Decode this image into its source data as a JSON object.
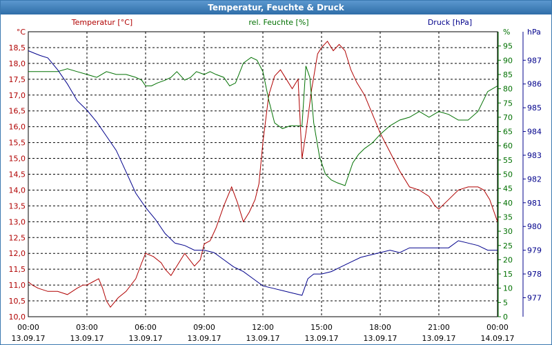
{
  "window": {
    "title": "Temperatur, Feuchte & Druck"
  },
  "colors": {
    "temperature": "#b00000",
    "humidity": "#007000",
    "pressure": "#00008b",
    "grid": "#000000"
  },
  "chart_data": {
    "type": "line",
    "title": "Temperatur, Feuchte & Druck",
    "grid": true,
    "x_ticks": [
      {
        "time": "00:00",
        "date": "13.09.17"
      },
      {
        "time": "03:00",
        "date": "13.09.17"
      },
      {
        "time": "06:00",
        "date": "13.09.17"
      },
      {
        "time": "09:00",
        "date": "13.09.17"
      },
      {
        "time": "12:00",
        "date": "13.09.17"
      },
      {
        "time": "15:00",
        "date": "13.09.17"
      },
      {
        "time": "18:00",
        "date": "13.09.17"
      },
      {
        "time": "21:00",
        "date": "13.09.17"
      },
      {
        "time": "00:00",
        "date": "14.09.17"
      }
    ],
    "x_range_hours": [
      0,
      24
    ],
    "axes": {
      "temperature": {
        "label": "Temperatur [°C]",
        "unit": "°C",
        "min": 10.0,
        "max": 19.0,
        "ticks": [
          "10,0",
          "10,5",
          "11,0",
          "11,5",
          "12,0",
          "12,5",
          "13,0",
          "13,5",
          "14,0",
          "14,5",
          "15,0",
          "15,5",
          "16,0",
          "16,5",
          "17,0",
          "17,5",
          "18,0",
          "18,5"
        ]
      },
      "humidity": {
        "label": "rel. Feuchte [%]",
        "unit": "%",
        "min": 0,
        "max": 100,
        "ticks": [
          "0",
          "5",
          "10",
          "15",
          "20",
          "25",
          "30",
          "35",
          "40",
          "45",
          "50",
          "55",
          "60",
          "65",
          "70",
          "75",
          "80",
          "85",
          "90",
          "95"
        ]
      },
      "pressure": {
        "label": "Druck [hPa]",
        "unit": "hPa",
        "min": 976.2,
        "max": 988.2,
        "ticks": [
          "977",
          "978",
          "979",
          "980",
          "981",
          "982",
          "983",
          "984",
          "985",
          "986",
          "987"
        ]
      }
    },
    "series": [
      {
        "name": "Temperatur [°C]",
        "axis": "temperature",
        "color": "#b00000",
        "x": [
          0,
          0.2,
          0.5,
          1,
          1.5,
          2,
          2.5,
          2.8,
          3,
          3.3,
          3.6,
          3.8,
          4,
          4.2,
          4.6,
          5,
          5.5,
          5.8,
          6,
          6.4,
          6.8,
          7,
          7.3,
          7.6,
          8,
          8.5,
          8.8,
          9,
          9.3,
          9.6,
          10,
          10.4,
          10.7,
          11,
          11.3,
          11.6,
          11.8,
          12,
          12.3,
          12.6,
          12.9,
          13.2,
          13.5,
          13.8,
          14,
          14.2,
          14.5,
          14.8,
          15,
          15.3,
          15.6,
          15.9,
          16.2,
          16.5,
          16.8,
          17.2,
          17.6,
          18,
          18.5,
          19,
          19.5,
          20,
          20.5,
          20.8,
          21,
          21.5,
          22,
          22.5,
          23,
          23.3,
          23.6,
          24
        ],
        "y": [
          11.1,
          11.0,
          10.9,
          10.8,
          10.8,
          10.7,
          10.9,
          11.0,
          11.0,
          11.1,
          11.2,
          10.9,
          10.5,
          10.3,
          10.6,
          10.8,
          11.2,
          11.7,
          12.0,
          11.9,
          11.7,
          11.5,
          11.3,
          11.6,
          12.0,
          11.6,
          11.8,
          12.3,
          12.4,
          12.8,
          13.5,
          14.1,
          13.6,
          13.0,
          13.3,
          13.7,
          14.2,
          15.5,
          17.0,
          17.6,
          17.8,
          17.5,
          17.2,
          17.5,
          15.0,
          15.8,
          17.2,
          18.3,
          18.5,
          18.7,
          18.4,
          18.6,
          18.4,
          17.8,
          17.4,
          17.0,
          16.4,
          15.8,
          15.2,
          14.6,
          14.1,
          14.0,
          13.8,
          13.5,
          13.4,
          13.7,
          14.0,
          14.1,
          14.1,
          14.0,
          13.7,
          13.0
        ]
      },
      {
        "name": "rel. Feuchte [%]",
        "axis": "humidity",
        "color": "#007000",
        "x": [
          0,
          0.5,
          1,
          1.5,
          2,
          2.5,
          3,
          3.5,
          4,
          4.5,
          5,
          5.5,
          5.8,
          6,
          6.3,
          6.6,
          7,
          7.3,
          7.6,
          8,
          8.3,
          8.6,
          9,
          9.3,
          9.6,
          10,
          10.3,
          10.6,
          11,
          11.4,
          11.7,
          12,
          12.3,
          12.6,
          13,
          13.4,
          13.8,
          14,
          14.2,
          14.4,
          14.6,
          14.9,
          15.2,
          15.5,
          15.8,
          16.2,
          16.6,
          16.9,
          17.2,
          17.6,
          18,
          18.5,
          19,
          19.5,
          20,
          20.5,
          21,
          21.5,
          22,
          22.5,
          23,
          23.5,
          24
        ],
        "y": [
          86,
          86,
          86,
          86,
          87,
          86,
          85,
          84,
          86,
          85,
          85,
          84,
          83,
          81,
          81,
          82,
          83,
          84,
          86,
          83,
          84,
          86,
          85,
          86,
          85,
          84,
          81,
          82,
          89,
          91,
          90,
          86,
          76,
          68,
          66,
          67,
          67,
          67,
          88,
          84,
          68,
          56,
          50,
          48,
          47,
          46,
          54,
          57,
          59,
          61,
          64,
          67,
          69,
          70,
          72,
          70,
          72,
          71,
          69,
          69,
          72,
          79,
          81
        ]
      },
      {
        "name": "Druck [hPa]",
        "axis": "pressure",
        "color": "#00008b",
        "x": [
          0,
          0.3,
          0.6,
          1,
          1.5,
          2,
          2.5,
          3,
          3.5,
          4,
          4.5,
          5,
          5.5,
          6,
          6.5,
          7,
          7.5,
          8,
          8.5,
          9,
          9.5,
          10,
          10.5,
          11,
          11.5,
          12,
          12.5,
          13,
          13.5,
          14,
          14.3,
          14.6,
          15,
          15.5,
          16,
          16.5,
          17,
          17.5,
          18,
          18.5,
          19,
          19.5,
          20,
          20.5,
          21,
          21.5,
          22,
          22.5,
          23,
          23.5,
          24
        ],
        "y": [
          987.4,
          987.3,
          987.2,
          987.1,
          986.6,
          986.0,
          985.3,
          984.9,
          984.4,
          983.8,
          983.2,
          982.3,
          981.4,
          980.8,
          980.3,
          979.7,
          979.3,
          979.2,
          979.0,
          979.0,
          978.9,
          978.6,
          978.3,
          978.1,
          977.8,
          977.5,
          977.4,
          977.3,
          977.2,
          977.1,
          977.8,
          978.0,
          978.0,
          978.1,
          978.3,
          978.5,
          978.7,
          978.8,
          978.9,
          979.0,
          978.9,
          979.1,
          979.1,
          979.1,
          979.1,
          979.1,
          979.4,
          979.3,
          979.2,
          979.0,
          979.0
        ]
      }
    ]
  }
}
